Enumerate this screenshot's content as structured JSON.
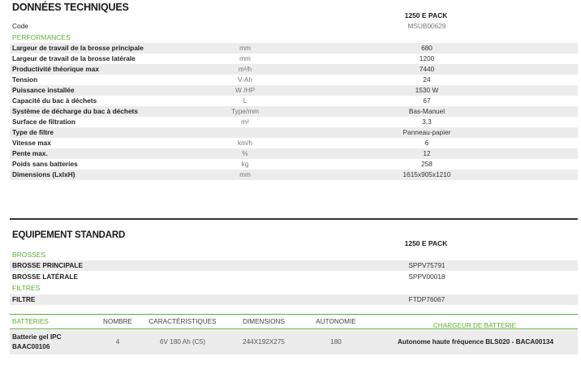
{
  "tech": {
    "title": "DONNÉES TECHNIQUES",
    "model": "1250 E PACK",
    "code_label": "Code",
    "code_value": "MSUB00629",
    "performances": "PERFORMANCES",
    "rows": [
      {
        "label": "Largeur de travail de la brosse principale",
        "unit": "mm",
        "value": "680"
      },
      {
        "label": "Largeur de travail de la brosse latérale",
        "unit": "mm",
        "value": "1200"
      },
      {
        "label": "Productivité théorique max",
        "unit": "m²/h",
        "value": "7440"
      },
      {
        "label": "Tension",
        "unit": "V-Ah",
        "value": "24"
      },
      {
        "label": "Puissance installée",
        "unit": "W /HP",
        "value": "1530 W"
      },
      {
        "label": "Capacité du bac à déchets",
        "unit": "L",
        "value": "67"
      },
      {
        "label": "Système de décharge du bac à déchets",
        "unit": "Type/mm",
        "value": "Bas-Manuel"
      },
      {
        "label": "Surface de filtration",
        "unit": "m²",
        "value": "3,3"
      },
      {
        "label": "Type de filtre",
        "unit": "",
        "value": "Panneau-papier"
      },
      {
        "label": "Vitesse max",
        "unit": "km/h",
        "value": "6"
      },
      {
        "label": "Pente max.",
        "unit": "%",
        "value": "12"
      },
      {
        "label": "Poids sans batteries",
        "unit": "kg",
        "value": "258"
      },
      {
        "label": "Dimensions (LxlxH)",
        "unit": "mm",
        "value": "1615x905x1210"
      }
    ]
  },
  "equip": {
    "title": "EQUIPEMENT STANDARD",
    "model": "1250 E PACK",
    "brosses": "BROSSES",
    "brosse_principale": {
      "label": "BROSSE PRINCIPALE",
      "value": "SPPV75791"
    },
    "brosse_laterale": {
      "label": "BROSSE LATÉRALE",
      "value": "SPPV00018"
    },
    "filtres": "FILTRES",
    "filtre": {
      "label": "FILTRE",
      "value": "FTDP76067"
    }
  },
  "batteries": {
    "headers": {
      "batteries": "BATTERIES",
      "nombre": "NOMBRE",
      "caracteristiques": "CARACTÉRISTIQUES",
      "dimensions": "DIMENSIONS",
      "autonomie": "AUTONOMIE",
      "chargeur": "CHARGEUR DE BATTERIE"
    },
    "row": {
      "name_line1": "Batterie gel IPC",
      "name_line2": "BAAC00106",
      "nombre": "4",
      "caracteristiques": "6V 180 Ah (C5)",
      "dimensions": "244X192X275",
      "autonomie": "180",
      "chargeur": "Autonome haute fréquence BLS020 - BACA00134"
    }
  },
  "colors": {
    "accent": "#5bb135",
    "shade": "#ececec",
    "divider": "#333333"
  }
}
